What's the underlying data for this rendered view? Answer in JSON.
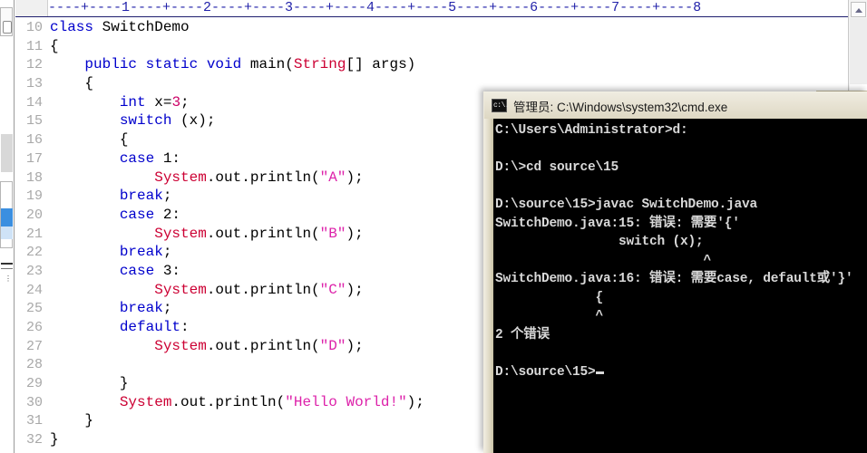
{
  "window": {
    "left_strip": {
      "icon_name": "panel-toggle-icon",
      "selected_marker": "active-item-marker"
    }
  },
  "editor": {
    "ruler": "----+----1----+----2----+----3----+----4----+----5----+----6----+----7----+----8",
    "scrollbar": {
      "up_arrow_label": "scroll-up"
    },
    "lines": [
      {
        "no": "10",
        "tokens": [
          {
            "t": "class ",
            "c": "kw"
          },
          {
            "t": "SwitchDemo",
            "c": "pln"
          }
        ]
      },
      {
        "no": "11",
        "tokens": [
          {
            "t": "{",
            "c": "pln"
          }
        ]
      },
      {
        "no": "12",
        "tokens": [
          {
            "t": "    ",
            "c": "pln"
          },
          {
            "t": "public static void ",
            "c": "kw"
          },
          {
            "t": "main(",
            "c": "pln"
          },
          {
            "t": "String",
            "c": "typ"
          },
          {
            "t": "[] args)",
            "c": "pln"
          }
        ]
      },
      {
        "no": "13",
        "tokens": [
          {
            "t": "    {",
            "c": "pln"
          }
        ]
      },
      {
        "no": "14",
        "tokens": [
          {
            "t": "        ",
            "c": "pln"
          },
          {
            "t": "int",
            "c": "kw"
          },
          {
            "t": " x=",
            "c": "pln"
          },
          {
            "t": "3",
            "c": "num"
          },
          {
            "t": ";",
            "c": "pln"
          }
        ]
      },
      {
        "no": "15",
        "tokens": [
          {
            "t": "        ",
            "c": "pln"
          },
          {
            "t": "switch",
            "c": "kw"
          },
          {
            "t": " (x);",
            "c": "pln"
          }
        ]
      },
      {
        "no": "16",
        "tokens": [
          {
            "t": "        {",
            "c": "pln"
          }
        ]
      },
      {
        "no": "17",
        "tokens": [
          {
            "t": "        ",
            "c": "pln"
          },
          {
            "t": "case",
            "c": "kw"
          },
          {
            "t": " 1:",
            "c": "pln"
          }
        ]
      },
      {
        "no": "18",
        "tokens": [
          {
            "t": "            ",
            "c": "pln"
          },
          {
            "t": "System",
            "c": "typ"
          },
          {
            "t": ".out.println(",
            "c": "pln"
          },
          {
            "t": "\"A\"",
            "c": "str"
          },
          {
            "t": ");",
            "c": "pln"
          }
        ]
      },
      {
        "no": "19",
        "tokens": [
          {
            "t": "        ",
            "c": "pln"
          },
          {
            "t": "break",
            "c": "kw"
          },
          {
            "t": ";",
            "c": "pln"
          }
        ]
      },
      {
        "no": "20",
        "tokens": [
          {
            "t": "        ",
            "c": "pln"
          },
          {
            "t": "case",
            "c": "kw"
          },
          {
            "t": " 2:",
            "c": "pln"
          }
        ]
      },
      {
        "no": "21",
        "tokens": [
          {
            "t": "            ",
            "c": "pln"
          },
          {
            "t": "System",
            "c": "typ"
          },
          {
            "t": ".out.println(",
            "c": "pln"
          },
          {
            "t": "\"B\"",
            "c": "str"
          },
          {
            "t": ");",
            "c": "pln"
          }
        ]
      },
      {
        "no": "22",
        "tokens": [
          {
            "t": "        ",
            "c": "pln"
          },
          {
            "t": "break",
            "c": "kw"
          },
          {
            "t": ";",
            "c": "pln"
          }
        ]
      },
      {
        "no": "23",
        "tokens": [
          {
            "t": "        ",
            "c": "pln"
          },
          {
            "t": "case",
            "c": "kw"
          },
          {
            "t": " 3:",
            "c": "pln"
          }
        ]
      },
      {
        "no": "24",
        "tokens": [
          {
            "t": "            ",
            "c": "pln"
          },
          {
            "t": "System",
            "c": "typ"
          },
          {
            "t": ".out.println(",
            "c": "pln"
          },
          {
            "t": "\"C\"",
            "c": "str"
          },
          {
            "t": ");",
            "c": "pln"
          }
        ]
      },
      {
        "no": "25",
        "tokens": [
          {
            "t": "        ",
            "c": "pln"
          },
          {
            "t": "break",
            "c": "kw"
          },
          {
            "t": ";",
            "c": "pln"
          }
        ]
      },
      {
        "no": "26",
        "tokens": [
          {
            "t": "        ",
            "c": "pln"
          },
          {
            "t": "default",
            "c": "kw"
          },
          {
            "t": ":",
            "c": "pln"
          }
        ]
      },
      {
        "no": "27",
        "tokens": [
          {
            "t": "            ",
            "c": "pln"
          },
          {
            "t": "System",
            "c": "typ"
          },
          {
            "t": ".out.println(",
            "c": "pln"
          },
          {
            "t": "\"D\"",
            "c": "str"
          },
          {
            "t": ");",
            "c": "pln"
          }
        ]
      },
      {
        "no": "28",
        "tokens": [
          {
            "t": "",
            "c": "pln"
          }
        ]
      },
      {
        "no": "29",
        "tokens": [
          {
            "t": "        }",
            "c": "pln"
          }
        ]
      },
      {
        "no": "30",
        "tokens": [
          {
            "t": "        ",
            "c": "pln"
          },
          {
            "t": "System",
            "c": "typ"
          },
          {
            "t": ".out.println(",
            "c": "pln"
          },
          {
            "t": "\"Hello World!\"",
            "c": "str"
          },
          {
            "t": ");",
            "c": "pln"
          }
        ]
      },
      {
        "no": "31",
        "tokens": [
          {
            "t": "    }",
            "c": "pln"
          }
        ]
      },
      {
        "no": "32",
        "tokens": [
          {
            "t": "}",
            "c": "pln"
          }
        ]
      }
    ]
  },
  "cmd": {
    "title": "管理员: C:\\Windows\\system32\\cmd.exe",
    "icon_name": "cmd-icon",
    "lines": [
      "C:\\Users\\Administrator>d:",
      "",
      "D:\\>cd source\\15",
      "",
      "D:\\source\\15>javac SwitchDemo.java",
      "SwitchDemo.java:15: 错误: 需要'{'",
      "                switch (x);",
      "                           ^",
      "SwitchDemo.java:16: 错误: 需要case, default或'}'",
      "             {",
      "             ^",
      "2 个错误",
      "",
      "D:\\source\\15>"
    ],
    "prompt_cursor": true
  },
  "colors": {
    "keyword": "#0000cc",
    "type": "#cc0033",
    "string": "#dd22aa",
    "number": "#cc0066",
    "line_number": "#a8a8a8",
    "ruler": "#2222aa",
    "console_bg": "#000000",
    "console_fg": "#d9d9d9",
    "titlebar": "#e6e1d1",
    "selection": "#3b8fe0"
  }
}
